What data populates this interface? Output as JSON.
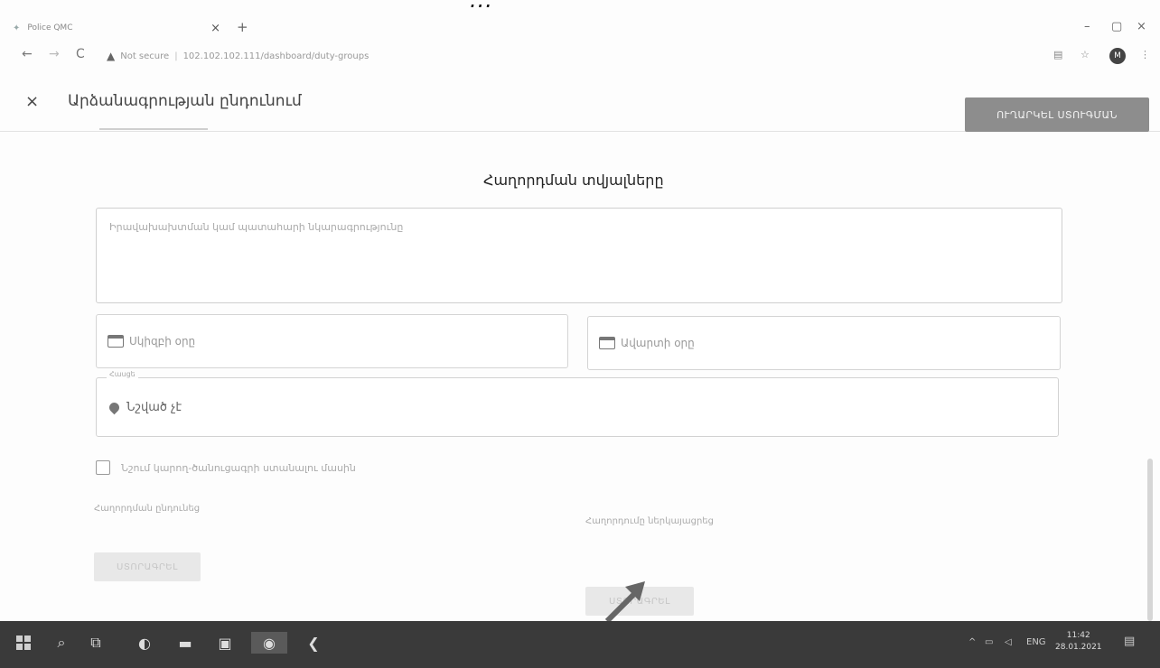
{
  "top_crop_text": "...",
  "browser": {
    "tab_title": "Police QMC",
    "tab_close": "×",
    "new_tab": "+",
    "back": "←",
    "forward": "→",
    "reload": "C",
    "security_label": "Not secure",
    "url": "102.102.102.111/dashboard/duty-groups",
    "minimize": "–",
    "maximize": "▢",
    "close": "×",
    "profile_initial": "M"
  },
  "header": {
    "close_symbol": "×",
    "title": "Արձանագրության ընդունում",
    "apply_button": "ՈՒՂԱՐԿԵԼ ՍՏՈՒԳՄԱՆ"
  },
  "form": {
    "section_title": "Հաղորդման տվյալները",
    "description_placeholder": "Իրավախախտման կամ պատահարի նկարագրությունը",
    "start_date_placeholder": "Սկիզբի օրը",
    "end_date_placeholder": "Ավարտի օրը",
    "location_legend": "Հասցե",
    "location_value": "Նշված չէ",
    "checkbox_label": "Նշում կարող-ծանուցագրի ստանալու մասին",
    "left_label": "Հաղորդման ընդունեց",
    "right_label": "Հաղորդումը ներկայացրեց",
    "left_button": "ՍՏՈՐԱԳՐԵԼ",
    "right_button": "ՍՏՈՐԱԳՐԵԼ"
  },
  "taskbar": {
    "tray_chevron": "^",
    "language": "ENG",
    "time": "11:42",
    "date": "28.01.2021"
  }
}
